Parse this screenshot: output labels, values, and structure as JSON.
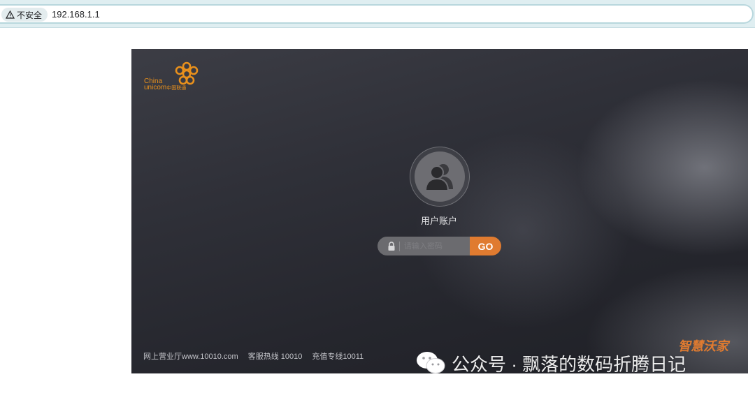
{
  "browser": {
    "security_label": "不安全",
    "url": "192.168.1.1"
  },
  "logo": {
    "line1": "China",
    "line2": "unicom",
    "line2_cn": "中国联通"
  },
  "login": {
    "account_label": "用户账户",
    "password_placeholder": "请输入密码",
    "go_label": "GO"
  },
  "footer": {
    "links": [
      "网上营业厅www.10010.com",
      "客服热线 10010",
      "充值专线10011"
    ]
  },
  "brand_mark": "智慧沃家",
  "watermark": "公众号 · 飘落的数码折腾日记",
  "colors": {
    "accent_orange": "#e07b30",
    "logo_orange": "#e8901c",
    "panel_dark": "#2a2b32"
  },
  "icons": {
    "security": "warning-triangle-icon",
    "avatar": "users-icon",
    "lock": "lock-icon",
    "watermark": "wechat-icon"
  }
}
